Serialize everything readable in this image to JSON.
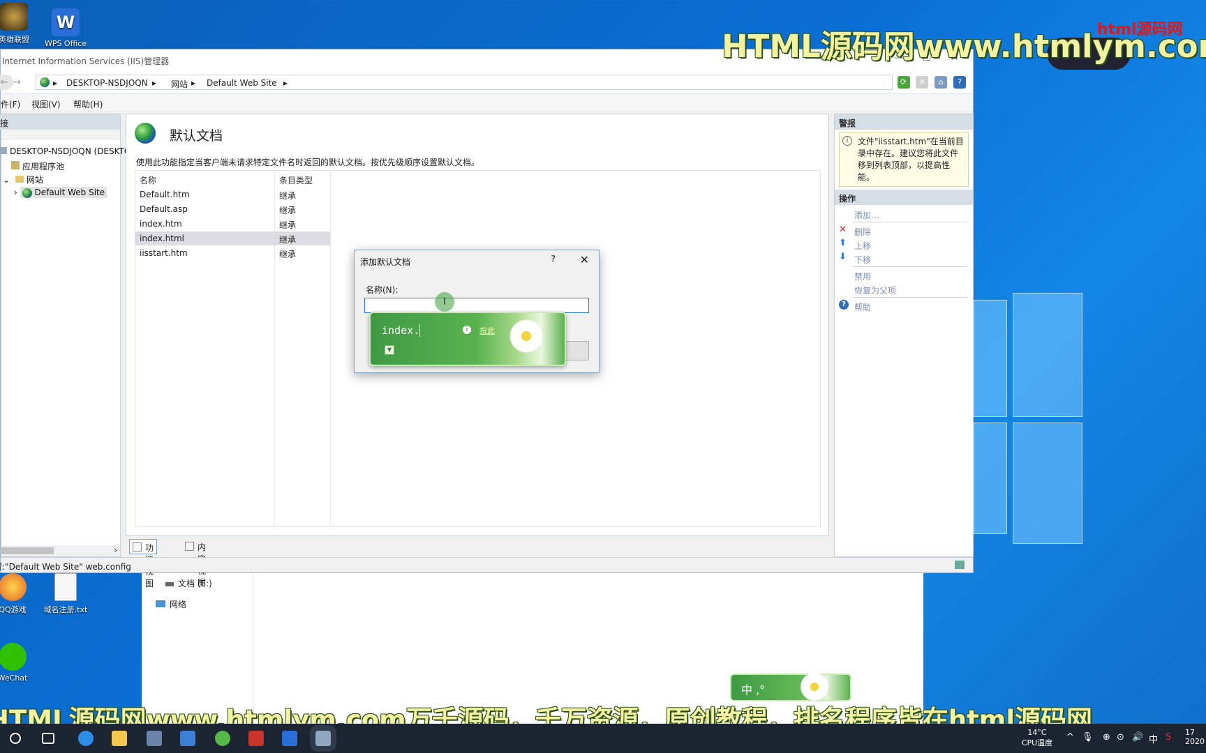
{
  "desktop": {
    "icons": [
      {
        "label": "英雄联盟"
      },
      {
        "label": "WPS Office"
      },
      {
        "label": "QQ游戏"
      },
      {
        "label": "域名注册.txt"
      },
      {
        "label": "WeChat"
      }
    ]
  },
  "explorer": {
    "items": [
      "文档 (E:)",
      "网络"
    ]
  },
  "iis": {
    "title": "Internet Information Services (IIS)管理器",
    "address": [
      "DESKTOP-NSDJOQN",
      "网站",
      "Default Web Site"
    ],
    "menu": [
      "文件(F)",
      "视图(V)",
      "帮助(H)"
    ],
    "connections": {
      "header": "连接",
      "tree": [
        {
          "label": "DESKTOP-NSDJOQN (DESKTOP-NSDJOQN\\",
          "expanded": true
        },
        {
          "label": "应用程序池"
        },
        {
          "label": "网站",
          "expanded": true
        },
        {
          "label": "Default Web Site",
          "selected": true
        }
      ]
    },
    "main": {
      "title": "默认文档",
      "description": "使用此功能指定当客户端未请求特定文件名时返回的默认文档。按优先级顺序设置默认文档。",
      "columns": [
        "名称",
        "条目类型"
      ],
      "rows": [
        {
          "name": "Default.htm",
          "type": "继承"
        },
        {
          "name": "Default.asp",
          "type": "继承"
        },
        {
          "name": "index.htm",
          "type": "继承"
        },
        {
          "name": "index.html",
          "type": "继承",
          "selected": true
        },
        {
          "name": "iisstart.htm",
          "type": "继承"
        }
      ],
      "tabs": [
        {
          "label": "功能视图",
          "active": true
        },
        {
          "label": "内容视图",
          "active": false
        }
      ]
    },
    "actions": {
      "alerts_header": "警报",
      "alert_text": "文件\"iisstart.htm\"在当前目录中存在。建议您将此文件移到列表顶部，以提高性能。",
      "ops_header": "操作",
      "items": [
        "添加...",
        "删除",
        "上移",
        "下移",
        "禁用",
        "恢复为父项",
        "帮助"
      ]
    },
    "status": "配置:\"Default Web Site\" web.config"
  },
  "dialog": {
    "title": "添加默认文档",
    "help": "?",
    "close": "✕",
    "label": "名称(N):",
    "value": ""
  },
  "ime": {
    "composition": "index.",
    "hint": "按此",
    "status": "中 ,°"
  },
  "watermarks": {
    "top": "HTML源码网www.htmlym.com",
    "top_red": "html源码网",
    "bottom": "HTML源码网www.htmlym.com万千源码，千万资源，原创教程，排名程序皆在html源码网"
  },
  "taskbar": {
    "weather": "14°C",
    "cpu_label": "CPU温度",
    "ime_lang": "中",
    "clock_time": "17",
    "clock_date": "2020"
  },
  "colors": {
    "accent": "#2a7bd3",
    "ime_green": "#4ea84a",
    "watermark_yellow": "#f2f2a2"
  }
}
